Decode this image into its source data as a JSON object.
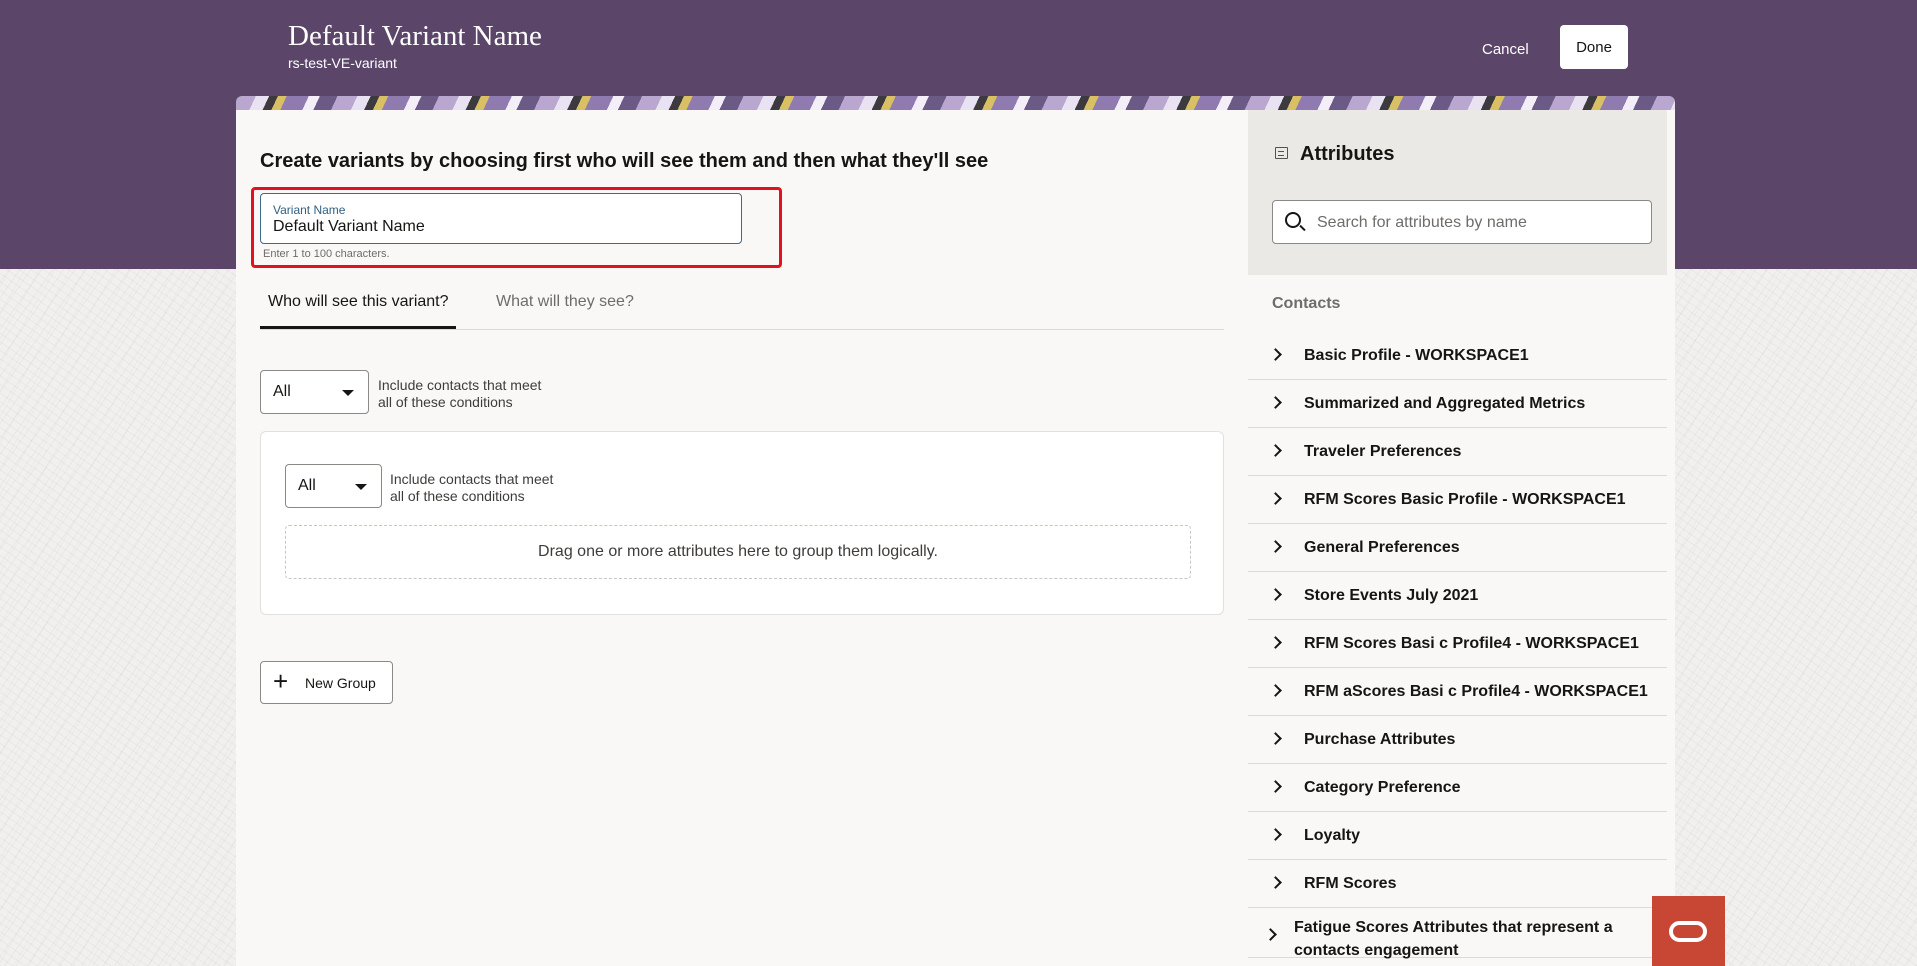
{
  "header": {
    "title": "Default Variant Name",
    "subtitle": "rs-test-VE-variant",
    "cancel_label": "Cancel",
    "done_label": "Done"
  },
  "main": {
    "heading": "Create variants by choosing first who will see them and then what they'll see",
    "variant_name": {
      "label": "Variant Name",
      "value": "Default Variant Name",
      "hint": "Enter 1 to 100 characters."
    },
    "tabs": [
      {
        "label": "Who will see this variant?",
        "selected": true
      },
      {
        "label": "What will they see?",
        "selected": false
      }
    ],
    "outer_condition": {
      "match": "All",
      "text_line1": "Include contacts that meet",
      "text_line2": "all of these conditions"
    },
    "group": {
      "match": "All",
      "text_line1": "Include contacts that meet",
      "text_line2": "all of these conditions",
      "drop_zone": "Drag one or more attributes here to group them logically."
    },
    "new_group_label": "New Group"
  },
  "attributes": {
    "title": "Attributes",
    "search_placeholder": "Search for attributes by name",
    "section_label": "Contacts",
    "items": [
      "Basic Profile - WORKSPACE1",
      "Summarized and Aggregated Metrics",
      "Traveler Preferences",
      "RFM Scores Basic Profile - WORKSPACE1",
      "General Preferences",
      "Store Events July 2021",
      "RFM Scores Basi c Profile4 - WORKSPACE1",
      "RFM aScores Basi c Profile4 - WORKSPACE1",
      "Purchase Attributes",
      "Category Preference",
      "Loyalty",
      "RFM Scores",
      "Fatigue Scores Attributes that represent a contacts engagement"
    ]
  },
  "icons": {
    "attributes": "attributes-panel-icon",
    "search": "search-icon",
    "expand": "chevron-right-icon",
    "add": "plus-icon",
    "dropdown": "caret-down-icon",
    "brand": "oracle-logo-icon"
  },
  "colors": {
    "header_bg": "#5b4568",
    "highlight": "#e0121f",
    "brand_red": "#c74634",
    "field_border": "#3d6b8a"
  }
}
